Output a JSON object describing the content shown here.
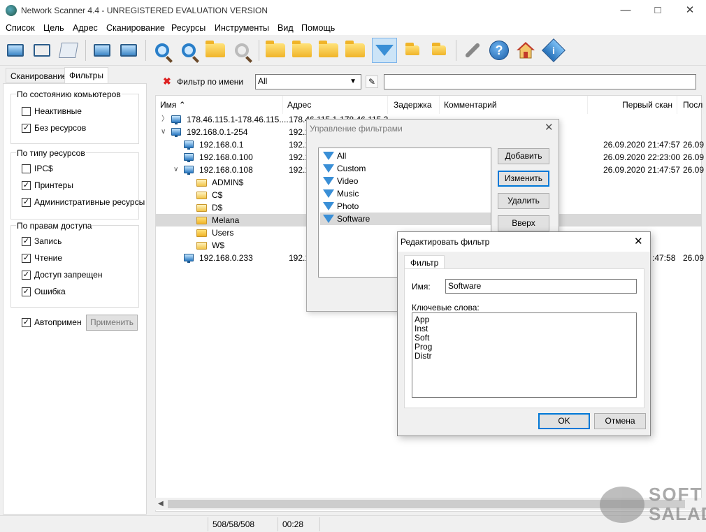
{
  "window": {
    "title": "Network Scanner 4.4 - UNREGISTERED EVALUATION VERSION"
  },
  "menu": [
    "Список",
    "Цель",
    "Адрес",
    "Сканирование",
    "Ресурсы",
    "Инструменты",
    "Вид",
    "Помощь"
  ],
  "left_panel": {
    "tabs": [
      "Сканирование",
      "Фильтры"
    ],
    "groups": [
      {
        "title": "По состоянию комьютеров",
        "items": [
          {
            "label": "Неактивные",
            "checked": false
          },
          {
            "label": "Без ресурсов",
            "checked": true
          }
        ]
      },
      {
        "title": "По типу ресурсов",
        "items": [
          {
            "label": "IPC$",
            "checked": false
          },
          {
            "label": "Принтеры",
            "checked": true
          },
          {
            "label": "Административные ресурсы",
            "checked": true
          }
        ]
      },
      {
        "title": "По правам доступа",
        "items": [
          {
            "label": "Запись",
            "checked": true
          },
          {
            "label": "Чтение",
            "checked": true
          },
          {
            "label": "Доступ запрещен",
            "checked": true
          },
          {
            "label": "Ошибка",
            "checked": true
          }
        ]
      }
    ],
    "auto_apply": {
      "label": "Автопримен",
      "checked": true
    },
    "apply_button": "Применить"
  },
  "filter_bar": {
    "label": "Фильтр по имени",
    "selected": "All",
    "text_value": ""
  },
  "columns": [
    "Имя",
    "Адрес",
    "Задержка",
    "Комментарий",
    "Первый скан",
    "Посл"
  ],
  "rows": [
    {
      "name": "178.46.115.1-178.46.115....",
      "addr": "178.46.115.1-178.46.115.2",
      "first": "",
      "last": ""
    },
    {
      "name": "192.168.0.1-254",
      "addr": "192.1",
      "first": "",
      "last": ""
    },
    {
      "name": "192.168.0.1",
      "addr": "192.1",
      "first": "26.09.2020 21:47:57",
      "last": "26.09"
    },
    {
      "name": "192.168.0.100",
      "addr": "192.1",
      "first": "26.09.2020 22:23:00",
      "last": "26.09"
    },
    {
      "name": "192.168.0.108",
      "addr": "192.1",
      "first": "26.09.2020 21:47:57",
      "last": "26.09"
    },
    {
      "name": "ADMIN$",
      "addr": "",
      "first": "",
      "last": ""
    },
    {
      "name": "C$",
      "addr": "",
      "first": "",
      "last": ""
    },
    {
      "name": "D$",
      "addr": "",
      "first": "",
      "last": ""
    },
    {
      "name": "Melana",
      "addr": "",
      "first": "",
      "last": ""
    },
    {
      "name": "Users",
      "addr": "",
      "first": "",
      "last": ""
    },
    {
      "name": "W$",
      "addr": "",
      "first": "",
      "last": ""
    },
    {
      "name": "192.168.0.233",
      "addr": "192.1",
      "first": ":47:58",
      "last": "26.09"
    }
  ],
  "manage_dialog": {
    "title": "Управление фильтрами",
    "filters": [
      "All",
      "Custom",
      "Video",
      "Music",
      "Photo",
      "Software"
    ],
    "buttons": [
      "Добавить",
      "Изменить",
      "Удалить",
      "Вверх"
    ]
  },
  "edit_dialog": {
    "title": "Редактировать фильтр",
    "tab": "Фильтр",
    "name_label": "Имя:",
    "name_value": "Software",
    "keywords_label": "Ключевые слова:",
    "keywords": [
      "App",
      "Inst",
      "Soft",
      "Prog",
      "Distr"
    ],
    "ok": "OK",
    "cancel": "Отмена"
  },
  "status": {
    "counts": "508/58/508",
    "time": "00:28"
  },
  "watermark": {
    "line1": "SOFT",
    "line2": "SALAD"
  }
}
